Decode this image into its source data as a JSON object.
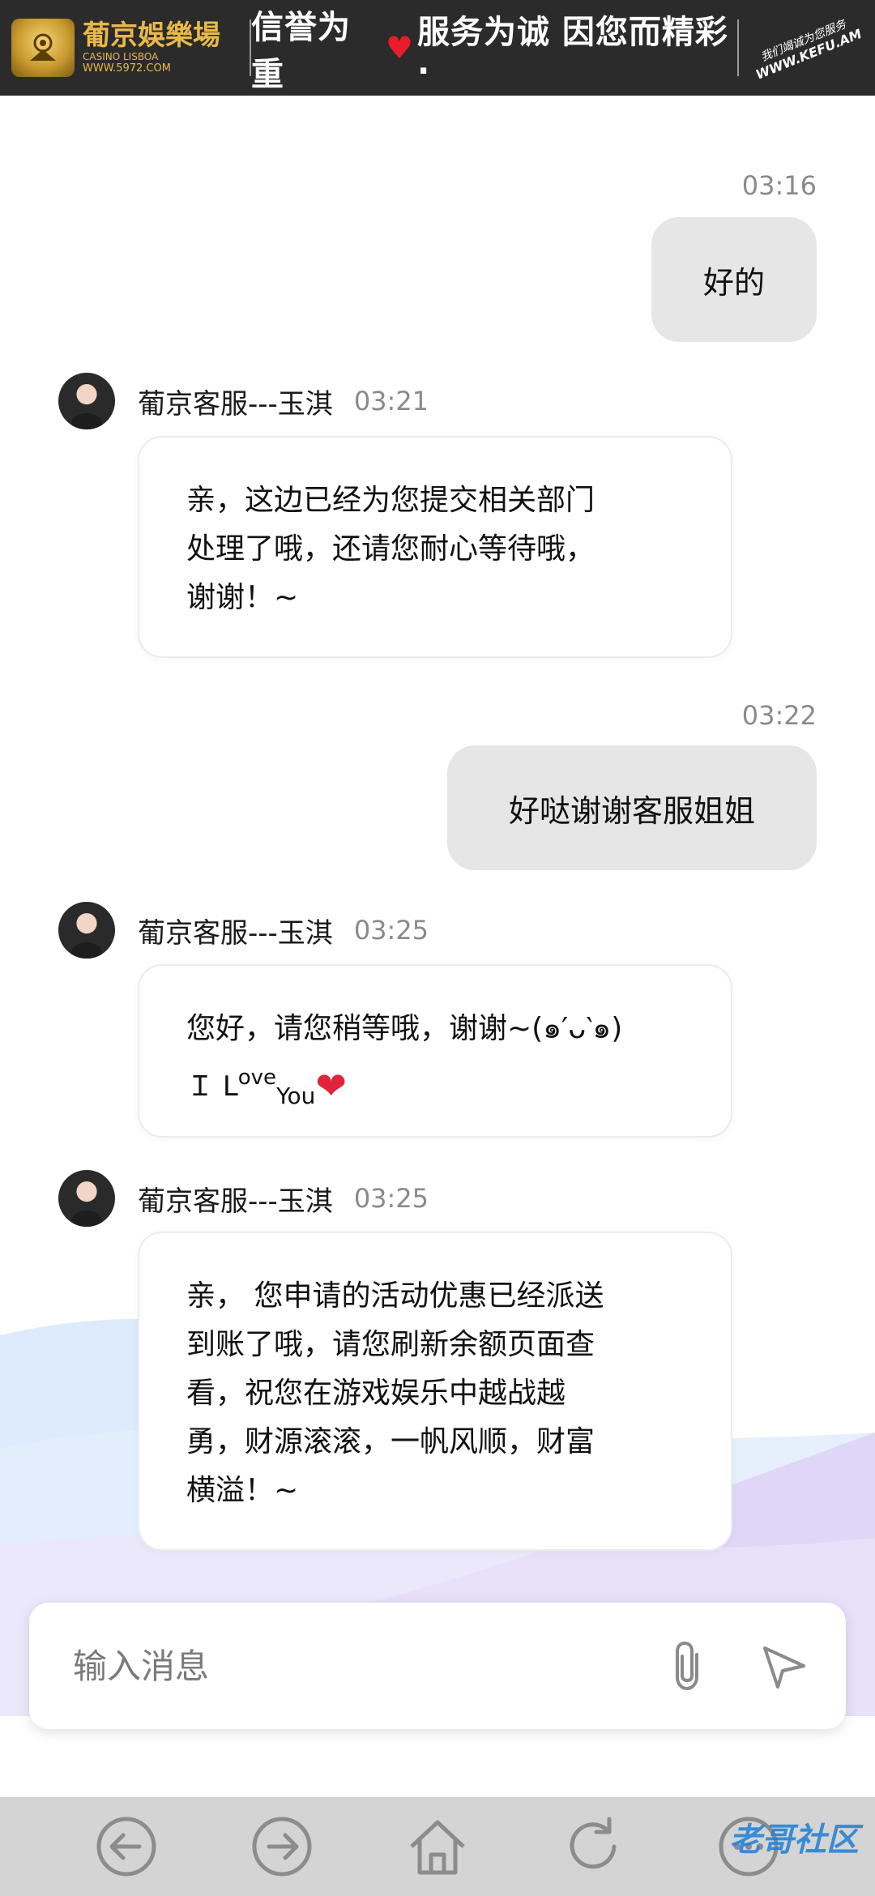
{
  "banner": {
    "brand_name": "葡京娛樂場",
    "brand_sub": "CASINO LISBOA",
    "brand_url": "WWW.5972.COM",
    "slogan_left": "信誉为重",
    "slogan_right": "服务为诚  因您而精彩·",
    "signature": "我们竭诚为您服务",
    "signature_url": "WWW.KEFU.AM"
  },
  "messages": [
    {
      "side": "right",
      "time": "03:16",
      "text": "好的"
    },
    {
      "side": "left",
      "name": "葡京客服---玉淇",
      "time": "03:21",
      "lines": [
        "亲，这边已经为您提交相关部门",
        "处理了哦，还请您耐心等待哦，",
        "谢谢！~"
      ]
    },
    {
      "side": "right",
      "time": "03:22",
      "text": "好哒谢谢客服姐姐"
    },
    {
      "side": "left",
      "name": "葡京客服---玉淇",
      "time": "03:25",
      "lines": [
        "您好，请您稍等哦，谢谢~(๑′ᴗ‵๑)"
      ],
      "love": {
        "i": "Ｉ",
        "l": "L",
        "ove": "ove",
        "you": "You"
      }
    },
    {
      "side": "left",
      "name": "葡京客服---玉淇",
      "time": "03:25",
      "lines": [
        "亲， 您申请的活动优惠已经派送",
        "到账了哦，请您刷新余额页面查",
        "看，祝您在游戏娱乐中越战越",
        "勇，财源滚滚，一帆风顺，财富",
        "横溢！~"
      ]
    }
  ],
  "input": {
    "placeholder": "输入消息"
  },
  "nav": [
    "back-icon",
    "forward-icon",
    "home-icon",
    "refresh-icon",
    "more-icon"
  ],
  "watermark": "老哥社区",
  "colors": {
    "banner_bg": "#2b2b2b",
    "gold": "#e8b84a",
    "bubble_right": "#e6e6e6",
    "heart": "#e0243b",
    "nav_bg": "#d4d4d4"
  }
}
